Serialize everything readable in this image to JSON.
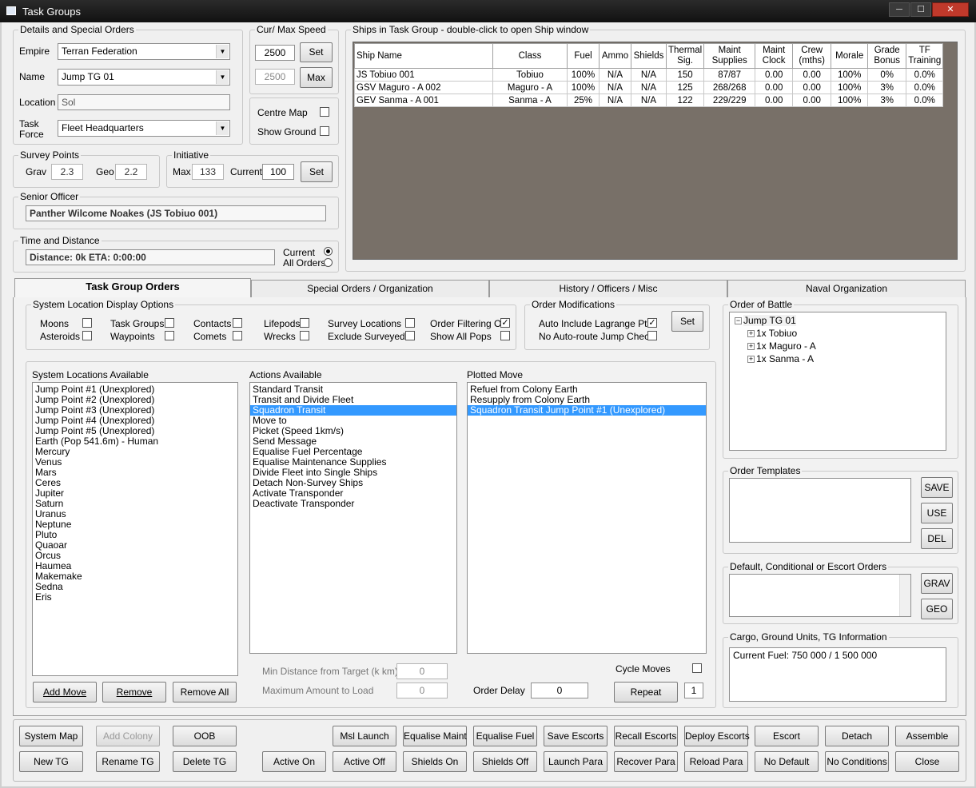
{
  "window": {
    "title": "Task Groups",
    "minimize": "─",
    "maximize": "☐",
    "close": "✕"
  },
  "details": {
    "legend": "Details and Special Orders",
    "empire_label": "Empire",
    "empire_value": "Terran Federation",
    "name_label": "Name",
    "name_value": "Jump TG 01",
    "location_label": "Location",
    "location_value": "Sol",
    "taskforce_label_1": "Task",
    "taskforce_label_2": "Force",
    "taskforce_value": "Fleet Headquarters"
  },
  "speed": {
    "legend": "Cur/ Max Speed",
    "current": "2500",
    "max": "2500",
    "set_label": "Set",
    "max_label": "Max"
  },
  "map_options": {
    "centre_map": "Centre Map",
    "show_ground": "Show Ground"
  },
  "survey": {
    "legend": "Survey Points",
    "grav_label": "Grav",
    "grav": "2.3",
    "geo_label": "Geo",
    "geo": "2.2"
  },
  "initiative": {
    "legend": "Initiative",
    "max_label": "Max",
    "max": "133",
    "current_label": "Current",
    "current": "100",
    "set_label": "Set"
  },
  "senior_officer": {
    "legend": "Senior Officer",
    "value": "Panther Wilcome Noakes (JS Tobiuo 001)"
  },
  "time_distance": {
    "legend": "Time and Distance",
    "value": "Distance:  0k   ETA:  0:00:00",
    "current_label": "Current",
    "all_orders_label": "All Orders"
  },
  "ships": {
    "legend": "Ships in Task Group - double-click to open Ship window",
    "headers": [
      "Ship Name",
      "Class",
      "Fuel",
      "Ammo",
      "Shields",
      "Thermal Sig.",
      "Maint Supplies",
      "Maint Clock",
      "Crew (mths)",
      "Morale",
      "Grade Bonus",
      "TF Training"
    ],
    "rows": [
      [
        "JS Tobiuo 001",
        "Tobiuo",
        "100%",
        "N/A",
        "N/A",
        "150",
        "87/87",
        "0.00",
        "0.00",
        "100%",
        "0%",
        "0.0%"
      ],
      [
        "GSV Maguro - A 002",
        "Maguro - A",
        "100%",
        "N/A",
        "N/A",
        "125",
        "268/268",
        "0.00",
        "0.00",
        "100%",
        "3%",
        "0.0%"
      ],
      [
        "GEV Sanma - A 001",
        "Sanma - A",
        "25%",
        "N/A",
        "N/A",
        "122",
        "229/229",
        "0.00",
        "0.00",
        "100%",
        "3%",
        "0.0%"
      ]
    ]
  },
  "tabs": [
    "Task Group Orders",
    "Special Orders / Organization",
    "History / Officers / Misc",
    "Naval Organization"
  ],
  "display_options": {
    "legend": "System Location Display Options",
    "moons": "Moons",
    "asteroids": "Asteroids",
    "task_groups": "Task Groups",
    "waypoints": "Waypoints",
    "contacts": "Contacts",
    "comets": "Comets",
    "lifepods": "Lifepods",
    "wrecks": "Wrecks",
    "survey_locations": "Survey Locations",
    "exclude_surveyed": "Exclude Surveyed",
    "order_filtering": "Order Filtering On",
    "show_all_pops": "Show All Pops",
    "check_mark": "✓"
  },
  "order_mods": {
    "legend": "Order Modifications",
    "auto_lagrange": "Auto Include Lagrange Pts",
    "no_autoroute": "No Auto-route Jump Check",
    "set_label": "Set"
  },
  "system_locations": {
    "label": "System Locations Available",
    "items": [
      "Jump Point #1  (Unexplored)",
      "Jump Point #2  (Unexplored)",
      "Jump Point #3  (Unexplored)",
      "Jump Point #4  (Unexplored)",
      "Jump Point #5  (Unexplored)",
      "Earth  (Pop 541.6m) - Human",
      "Mercury",
      "Venus",
      "Mars",
      "Ceres",
      "Jupiter",
      "Saturn",
      "Uranus",
      "Neptune",
      "Pluto",
      "Quaoar",
      "Orcus",
      "Haumea",
      "Makemake",
      "Sedna",
      "Eris"
    ]
  },
  "actions": {
    "label": "Actions Available",
    "items": [
      "Standard Transit",
      "Transit and Divide Fleet",
      "Squadron Transit",
      "Move to",
      "Picket (Speed 1km/s)",
      "Send Message",
      "Equalise Fuel Percentage",
      "Equalise Maintenance Supplies",
      "Divide Fleet into Single Ships",
      "Detach Non-Survey Ships",
      "Activate Transponder",
      "Deactivate Transponder"
    ],
    "selected": 2
  },
  "plotted": {
    "label": "Plotted Move",
    "items": [
      "Refuel from Colony Earth",
      "Resupply from Colony Earth",
      "Squadron Transit Jump Point #1  (Unexplored)"
    ],
    "selected": 2
  },
  "move_controls": {
    "add_move": "Add Move",
    "remove": "Remove",
    "remove_all": "Remove All",
    "min_distance_label": "Min Distance from Target (k km)",
    "min_distance": "0",
    "max_load_label": "Maximum Amount to Load",
    "max_load": "0",
    "order_delay_label": "Order Delay",
    "order_delay": "0",
    "cycle_moves": "Cycle Moves",
    "repeat": "Repeat",
    "repeat_count": "1"
  },
  "order_of_battle": {
    "legend": "Order of Battle",
    "root": "Jump TG 01",
    "children": [
      "1x Tobiuo",
      "1x Maguro - A",
      "1x Sanma - A"
    ],
    "collapse_glyph": "−",
    "expand_glyph": "+"
  },
  "order_templates": {
    "legend": "Order Templates",
    "save": "SAVE",
    "use": "USE",
    "del": "DEL"
  },
  "default_orders": {
    "legend": "Default, Conditional or Escort Orders",
    "grav": "GRAV",
    "geo": "GEO"
  },
  "cargo": {
    "legend": "Cargo, Ground Units, TG Information",
    "text": "Current Fuel: 750 000 / 1 500 000"
  },
  "bottom_row1": [
    "System Map",
    "Add Colony",
    "OOB",
    "Msl Launch",
    "Equalise Maint",
    "Equalise Fuel",
    "Save Escorts",
    "Recall Escorts",
    "Deploy Escorts",
    "Escort",
    "Detach",
    "Assemble"
  ],
  "bottom_row2": [
    "New TG",
    "Rename TG",
    "Delete TG",
    "Active On",
    "Active Off",
    "Shields On",
    "Shields Off",
    "Launch Para",
    "Recover Para",
    "Reload Para",
    "No Default",
    "No Conditions",
    "Close"
  ]
}
